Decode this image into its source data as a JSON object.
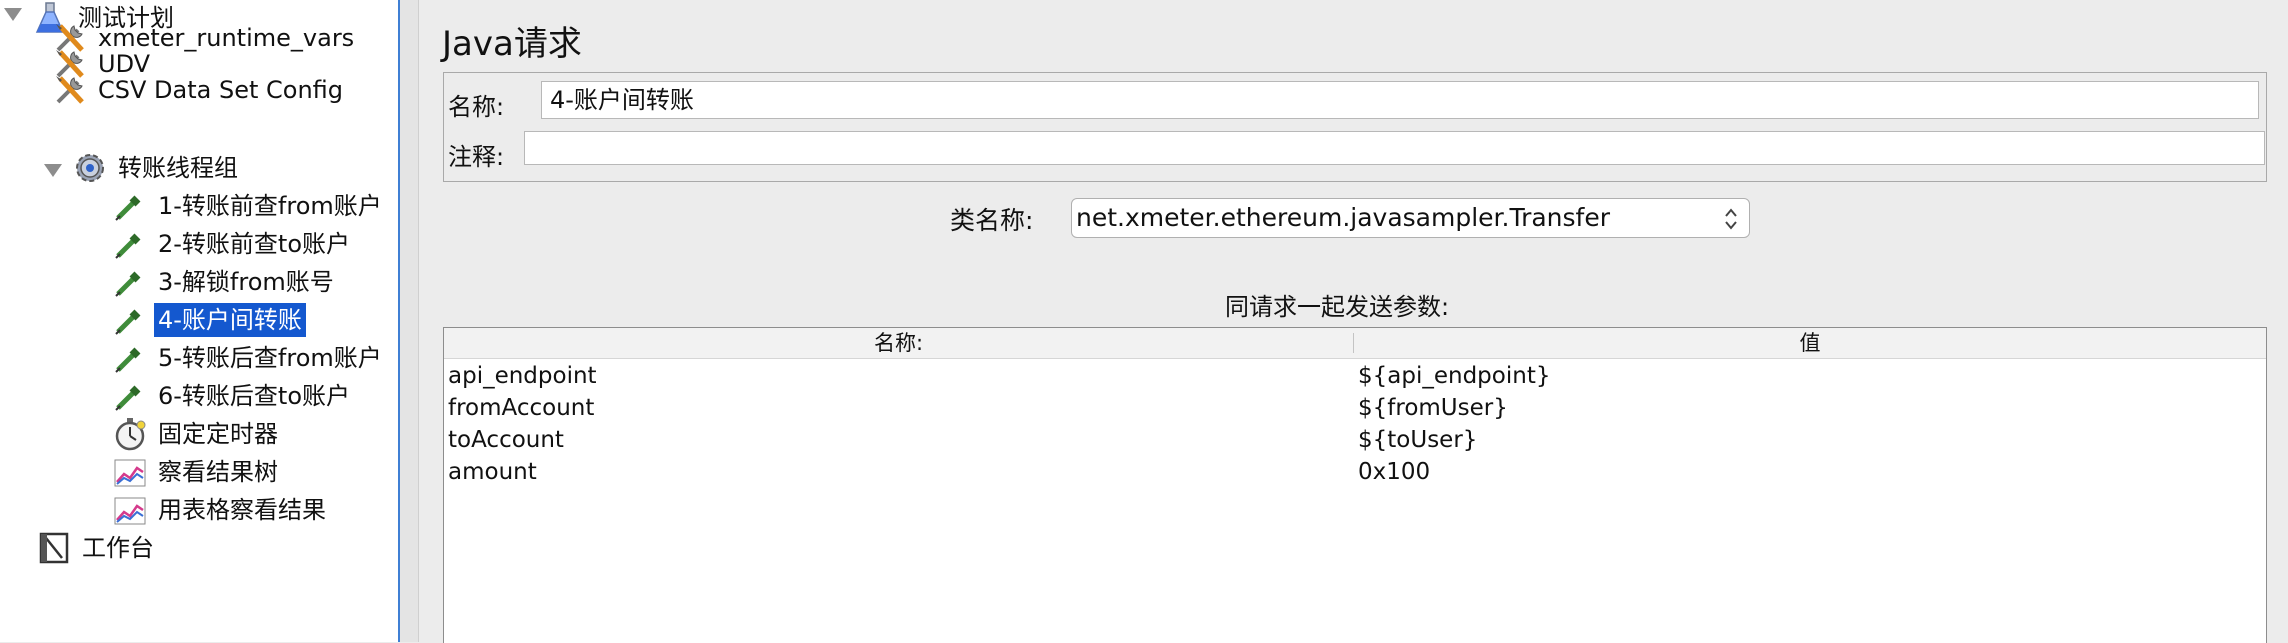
{
  "tree": {
    "root": "测试计划",
    "config_items": [
      "xmeter_runtime_vars",
      "UDV",
      "CSV Data Set Config"
    ],
    "thread_group": "转账线程组",
    "samplers": [
      "1-转账前查from账户",
      "2-转账前查to账户",
      "3-解锁from账号",
      "4-账户间转账",
      "5-转账后查from账户",
      "6-转账后查to账户"
    ],
    "selected": "4-账户间转账",
    "timer": "固定定时器",
    "listeners": [
      "察看结果树",
      "用表格察看结果"
    ],
    "workbench": "工作台"
  },
  "panel": {
    "title": "Java请求",
    "name_label": "名称:",
    "name_value": "4-账户间转账",
    "comment_label": "注释:",
    "comment_value": "",
    "classname_label": "类名称:",
    "classname_value": "net.xmeter.ethereum.javasampler.Transfer",
    "params_title": "同请求一起发送参数:"
  },
  "params_table": {
    "headers": [
      "名称:",
      "值"
    ],
    "rows": [
      [
        "api_endpoint",
        "${api_endpoint}"
      ],
      [
        "fromAccount",
        "${fromUser}"
      ],
      [
        "toAccount",
        "${toUser}"
      ],
      [
        "amount",
        "0x100"
      ]
    ]
  },
  "colors": {
    "selection": "#1458cf",
    "panel_bg": "#ececec",
    "divider_accent": "#3f7fd4"
  }
}
